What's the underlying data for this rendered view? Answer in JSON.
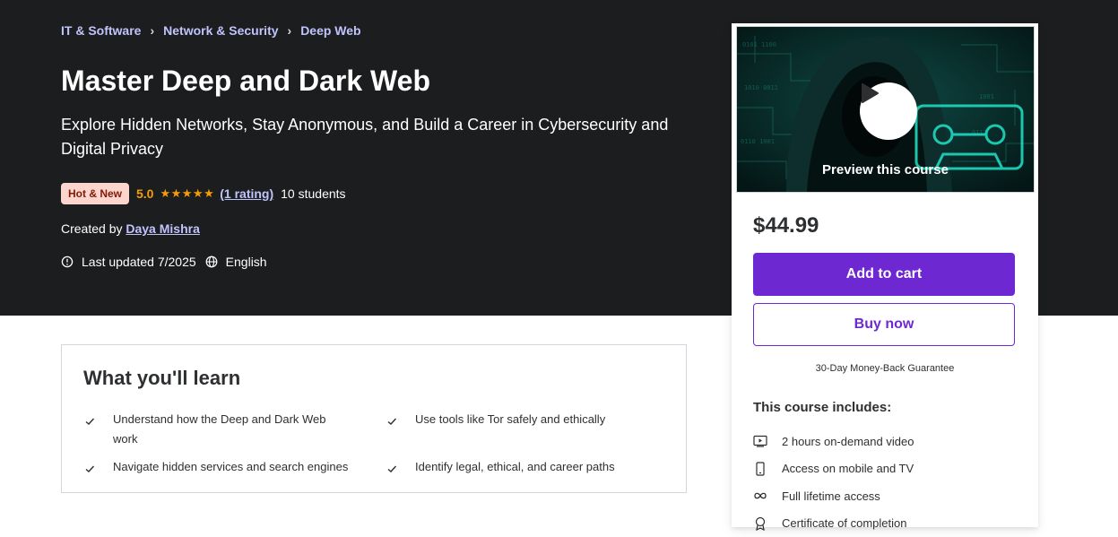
{
  "breadcrumb": [
    "IT & Software",
    "Network & Security",
    "Deep Web"
  ],
  "course": {
    "title": "Master Deep and Dark Web",
    "subtitle": "Explore Hidden Networks, Stay Anonymous, and Build a Career in Cybersecurity and Digital Privacy",
    "badge": "Hot & New",
    "rating": "5.0",
    "stars": "★★★★★",
    "rating_count": "(1 rating)",
    "students": "10 students",
    "created_by_label": "Created by",
    "author": "Daya Mishra",
    "last_updated": "Last updated 7/2025",
    "language": "English"
  },
  "sidebar": {
    "preview_label": "Preview this course",
    "price": "$44.99",
    "add_to_cart": "Add to cart",
    "buy_now": "Buy now",
    "guarantee": "30-Day Money-Back Guarantee",
    "includes_title": "This course includes:",
    "includes": [
      {
        "icon": "video-icon",
        "text": "2 hours on-demand video"
      },
      {
        "icon": "mobile-icon",
        "text": "Access on mobile and TV"
      },
      {
        "icon": "infinity-icon",
        "text": "Full lifetime access"
      },
      {
        "icon": "certificate-icon",
        "text": "Certificate of completion"
      }
    ]
  },
  "learn": {
    "title": "What you'll learn",
    "items": [
      "Understand how the Deep and Dark Web work",
      "Use tools like Tor safely and ethically",
      "Navigate hidden services and search engines",
      "Identify legal, ethical, and career paths"
    ]
  },
  "colors": {
    "hero_bg": "#1c1d1f",
    "accent": "#6d28d2",
    "link_light": "#c0c4fc",
    "star": "#f69c08"
  }
}
